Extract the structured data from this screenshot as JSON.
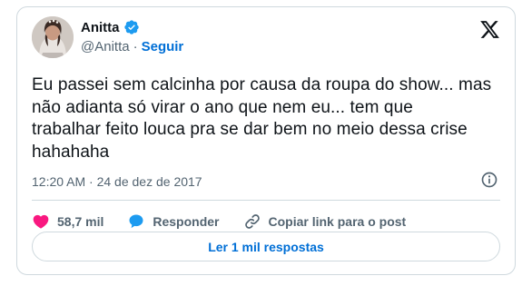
{
  "author": {
    "display_name": "Anitta",
    "handle": "@Anitta",
    "separator": "·",
    "follow_label": "Seguir",
    "verified_icon": "verified-badge-icon",
    "avatar": "profile-avatar"
  },
  "platform_logo": "x-logo-icon",
  "tweet": {
    "text_lines": [
      "Eu passei sem calcinha por causa da roupa do show... mas",
      "não adianta só virar o ano que nem eu... tem que",
      "trabalhar feito louca pra se dar bem no meio dessa crise",
      "hahahaha"
    ],
    "timestamp": "12:20 AM · 24 de dez de 2017"
  },
  "actions": {
    "likes_count": "58,7 mil",
    "reply_label": "Responder",
    "copy_link_label": "Copiar link para o post"
  },
  "read_replies_label": "Ler 1 mil respostas",
  "colors": {
    "text": "#0f1419",
    "secondary": "#536471",
    "link": "#006fd6",
    "like": "#f91880",
    "reply": "#1d9bf0",
    "border": "#cfd9de"
  }
}
